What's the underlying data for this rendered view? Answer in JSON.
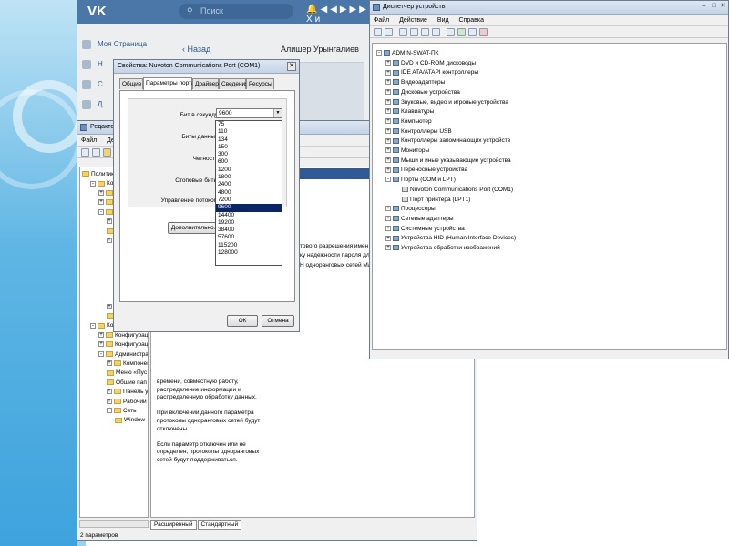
{
  "vk": {
    "logo": "VK",
    "search_placeholder": "Поиск",
    "header_user_partial": "Хи",
    "sidebar": [
      {
        "label": "Моя Страница"
      },
      {
        "label": "Н"
      },
      {
        "label": "С"
      },
      {
        "label": "Д"
      }
    ],
    "back_label": "Назад",
    "conversation_user": "Алишер Урынгалиев"
  },
  "gpe": {
    "title": "Редактор",
    "menu": [
      "Файл",
      "Дей"
    ],
    "tree": [
      {
        "label": "Политика",
        "indent": 0,
        "exp": ""
      },
      {
        "label": "Конфи",
        "indent": 1,
        "exp": "-"
      },
      {
        "label": "Конф",
        "indent": 2,
        "exp": "+"
      },
      {
        "label": "Конф",
        "indent": 2,
        "exp": "+"
      },
      {
        "label": "Адм",
        "indent": 2,
        "exp": "-"
      },
      {
        "label": "",
        "indent": 3,
        "exp": "+"
      },
      {
        "label": "",
        "indent": 3,
        "exp": ""
      },
      {
        "label": "",
        "indent": 3,
        "exp": "+"
      },
      {
        "label": "Параме",
        "indent": 4,
        "exp": "+"
      },
      {
        "label": "Параме",
        "indent": 4,
        "exp": ""
      },
      {
        "label": "Планир",
        "indent": 4,
        "exp": "+"
      },
      {
        "label": "Сервер",
        "indent": 4,
        "exp": ""
      },
      {
        "label": "Сетевь",
        "indent": 4,
        "exp": "+"
      },
      {
        "label": "Фонова",
        "indent": 4,
        "exp": ""
      },
      {
        "label": "Система",
        "indent": 3,
        "exp": "+"
      },
      {
        "label": "Все парам",
        "indent": 3,
        "exp": ""
      },
      {
        "label": "Конфигурация п",
        "indent": 1,
        "exp": "-"
      },
      {
        "label": "Конфигурация",
        "indent": 2,
        "exp": "+"
      },
      {
        "label": "Конфигурация",
        "indent": 2,
        "exp": "+"
      },
      {
        "label": "Администрати",
        "indent": 2,
        "exp": "-"
      },
      {
        "label": "Компонент",
        "indent": 3,
        "exp": "+"
      },
      {
        "label": "Меню «Пус",
        "indent": 3,
        "exp": ""
      },
      {
        "label": "Общие пап",
        "indent": 3,
        "exp": ""
      },
      {
        "label": "Панель упр",
        "indent": 3,
        "exp": "+"
      },
      {
        "label": "Рабочий ст",
        "indent": 3,
        "exp": "+"
      },
      {
        "label": "Сеть",
        "indent": 3,
        "exp": "-"
      },
      {
        "label": "Window",
        "indent": 4,
        "exp": ""
      }
    ],
    "right_text": [
      "тового разрешения имен",
      "ку надежности пароля для пр",
      "Н одноранговых сетей Майкро"
    ],
    "desc_lines": [
      "времени, совместную работу,",
      "распределение информации и",
      "распределенную обработку данных.",
      "",
      "При включении данного параметра",
      "протоколы одноранговых сетей будут",
      "отключены.",
      "",
      "Если параметр отключен или не",
      "определен, протоколы одноранговых",
      "сетей будут поддерживаться."
    ],
    "tabs": [
      "Расширенный",
      "Стандартный"
    ],
    "status": "2 параметров"
  },
  "dialog": {
    "title": "Свойства: Nuvoton Communications Port (COM1)",
    "tabs": [
      "Общие",
      "Параметры порта",
      "Драйвер",
      "Сведения",
      "Ресурсы"
    ],
    "fields": {
      "bits_per_second": "Бит в секунду:",
      "data_bits": "Биты данных:",
      "parity": "Четность:",
      "stop_bits": "Стоповые биты:",
      "flow_control": "Управление потоком:"
    },
    "combo_value": "9600",
    "options": [
      "75",
      "110",
      "134",
      "150",
      "300",
      "600",
      "1200",
      "1800",
      "2400",
      "4800",
      "7200",
      "9600",
      "14400",
      "19200",
      "38400",
      "57600",
      "115200",
      "128000"
    ],
    "selected": "9600",
    "advanced_label": "Дополнительно...",
    "ok_label": "ОК",
    "cancel_label": "Отмена"
  },
  "dm": {
    "title": "Диспетчер устройств",
    "menu": [
      "Файл",
      "Действие",
      "Вид",
      "Справка"
    ],
    "tree": [
      {
        "label": "ADMIN-SWAT-ПК",
        "indent": 0,
        "exp": "-",
        "port": false
      },
      {
        "label": "DVD и CD-ROM дисководы",
        "indent": 1,
        "exp": "+",
        "port": false
      },
      {
        "label": "IDE ATA/ATAPI контроллеры",
        "indent": 1,
        "exp": "+",
        "port": false
      },
      {
        "label": "Видеоадаптеры",
        "indent": 1,
        "exp": "+",
        "port": false
      },
      {
        "label": "Дисковые устройства",
        "indent": 1,
        "exp": "+",
        "port": false
      },
      {
        "label": "Звуковые, видео и игровые устройства",
        "indent": 1,
        "exp": "+",
        "port": false
      },
      {
        "label": "Клавиатуры",
        "indent": 1,
        "exp": "+",
        "port": false
      },
      {
        "label": "Компьютер",
        "indent": 1,
        "exp": "+",
        "port": false
      },
      {
        "label": "Контроллеры USB",
        "indent": 1,
        "exp": "+",
        "port": false
      },
      {
        "label": "Контроллеры запоминающих устройств",
        "indent": 1,
        "exp": "+",
        "port": false
      },
      {
        "label": "Мониторы",
        "indent": 1,
        "exp": "+",
        "port": false
      },
      {
        "label": "Мыши и иные указывающие устройства",
        "indent": 1,
        "exp": "+",
        "port": false
      },
      {
        "label": "Переносные устройства",
        "indent": 1,
        "exp": "+",
        "port": false
      },
      {
        "label": "Порты (COM и LPT)",
        "indent": 1,
        "exp": "-",
        "port": false
      },
      {
        "label": "Nuvoton Communications Port (COM1)",
        "indent": 2,
        "exp": "",
        "port": true
      },
      {
        "label": "Порт принтера (LPT1)",
        "indent": 2,
        "exp": "",
        "port": true
      },
      {
        "label": "Процессоры",
        "indent": 1,
        "exp": "+",
        "port": false
      },
      {
        "label": "Сетевые адаптеры",
        "indent": 1,
        "exp": "+",
        "port": false
      },
      {
        "label": "Системные устройства",
        "indent": 1,
        "exp": "+",
        "port": false
      },
      {
        "label": "Устройства HID (Human Interface Devices)",
        "indent": 1,
        "exp": "+",
        "port": false
      },
      {
        "label": "Устройства обработки изображений",
        "indent": 1,
        "exp": "+",
        "port": false
      }
    ]
  }
}
